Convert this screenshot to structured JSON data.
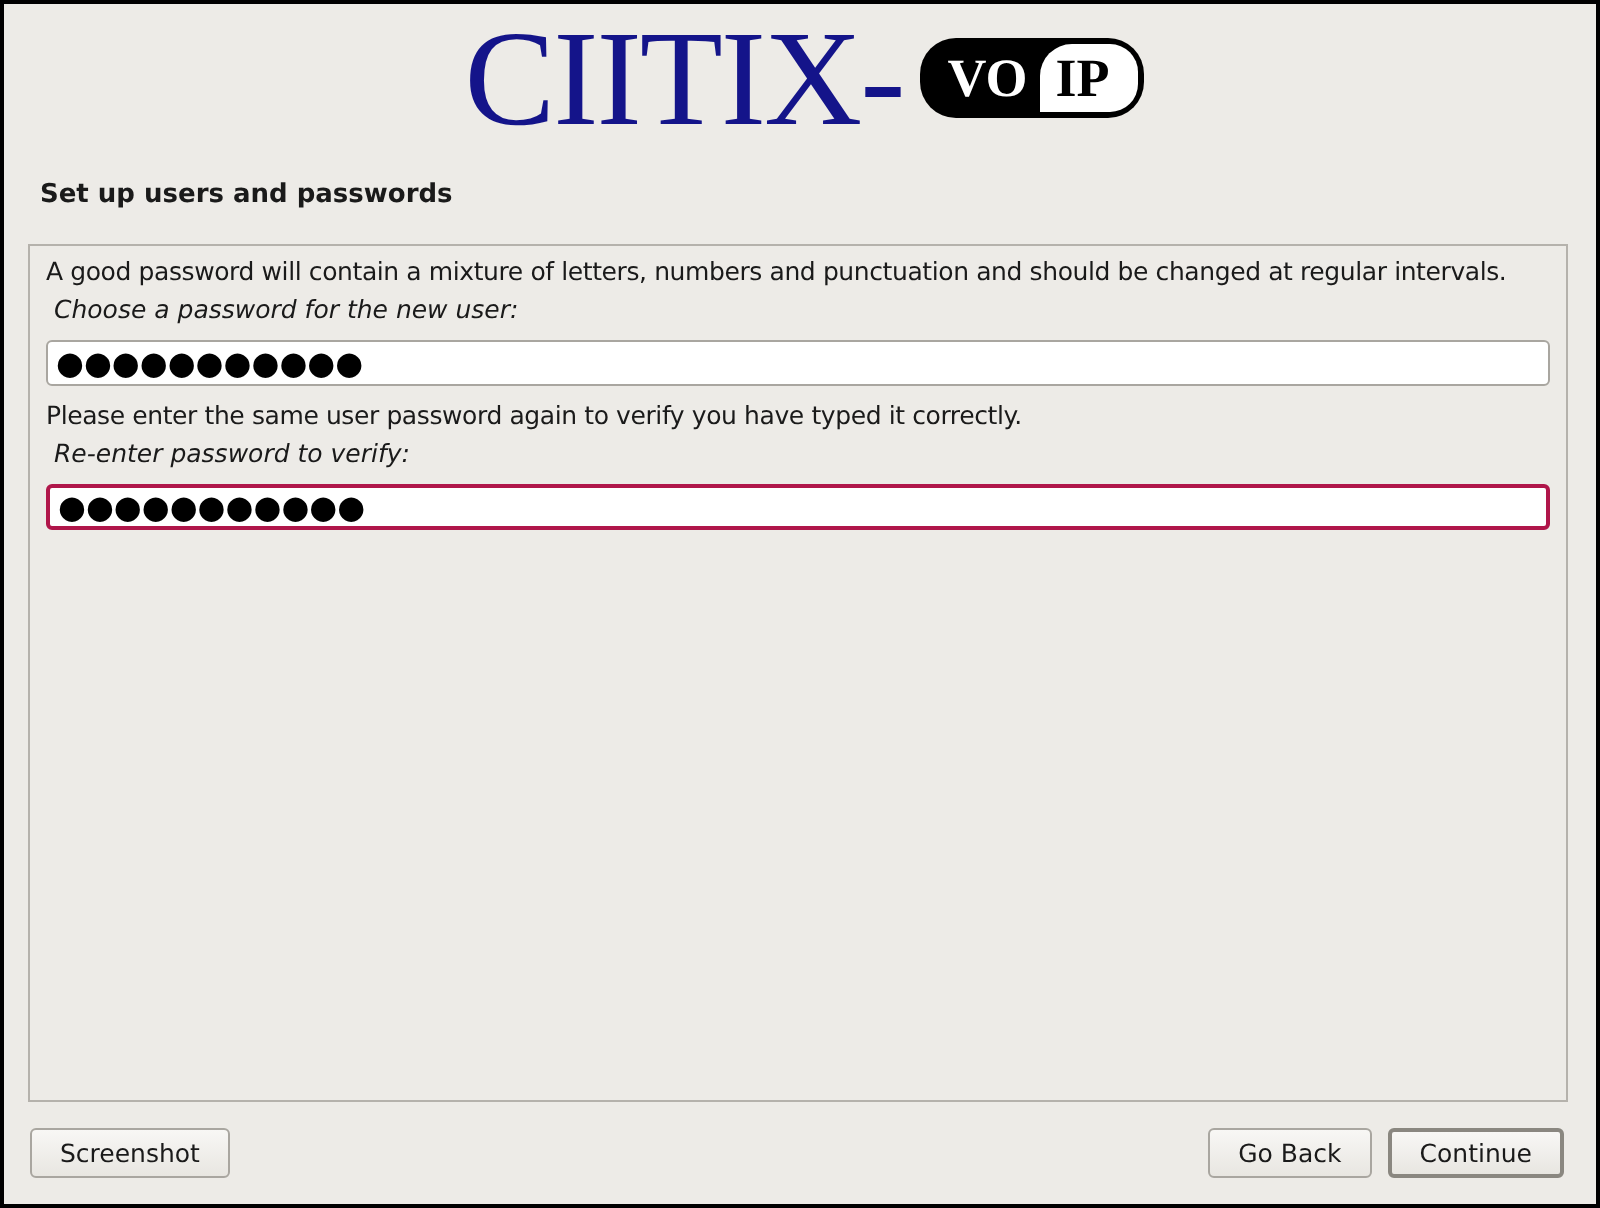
{
  "logo": {
    "name": "CIITIX-",
    "badge_left": "VO",
    "badge_right": "IP"
  },
  "heading": "Set up users and passwords",
  "panel": {
    "items": [
      {
        "kind": "text",
        "text": "A good password will contain a mixture of letters, numbers and punctuation and should be changed at regular intervals."
      },
      {
        "kind": "label",
        "text": "Choose a password for the new user:"
      },
      {
        "kind": "field",
        "value": "●●●●●●●●●●●",
        "focused": false
      },
      {
        "kind": "text",
        "text": "Please enter the same user password again to verify you have typed it correctly."
      },
      {
        "kind": "label",
        "text": "Re-enter password to verify:"
      },
      {
        "kind": "field",
        "value": "●●●●●●●●●●●",
        "focused": true
      }
    ]
  },
  "buttons": [
    {
      "label": "Screenshot",
      "default": false
    },
    {
      "label": "Go Back",
      "default": false
    },
    {
      "label": "Continue",
      "default": true
    }
  ]
}
